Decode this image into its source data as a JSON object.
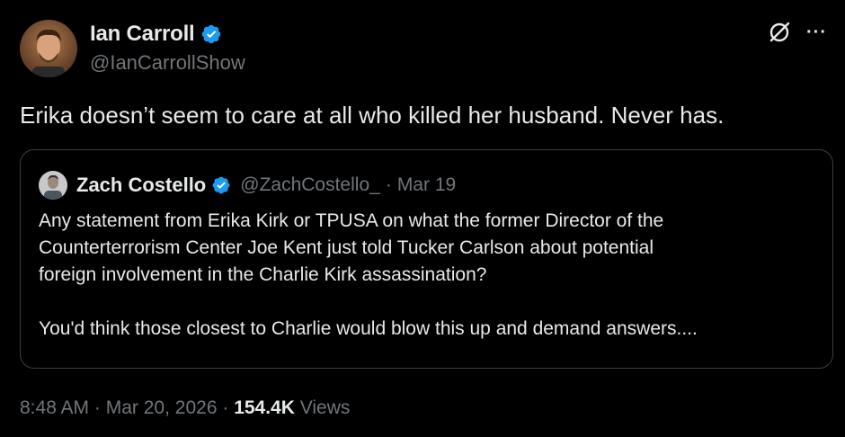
{
  "author": {
    "name": "Ian Carroll",
    "handle": "@IanCarrollShow",
    "verified": true
  },
  "tweet": {
    "text": "Erika doesn’t seem to care at all who killed her husband. Never has."
  },
  "quoted_tweet": {
    "author_name": "Zach Costello",
    "author_handle": "@ZachCostello_",
    "separator": "·",
    "date": "Mar 19",
    "verified": true,
    "body_lines": [
      "Any statement from Erika Kirk or TPUSA on what the former Director of the",
      "Counterterrorism Center Joe Kent just told Tucker Carlson about potential",
      "foreign involvement in the Charlie Kirk assassination?"
    ],
    "body_paragraph2": "You'd think those closest to Charlie would blow this up and demand answers...."
  },
  "meta": {
    "time": "8:48 AM",
    "sep1": "·",
    "date": "Mar 20, 2026",
    "sep2": "·",
    "views_count": "154.4K",
    "views_label": "Views"
  },
  "icons": {
    "verified": "verified-badge-icon",
    "grok": "grok-icon",
    "more": "more-options-icon"
  },
  "colors": {
    "background": "#000000",
    "text_primary": "#e7e9ea",
    "text_secondary": "#71767b",
    "verified_blue": "#1d9bf0",
    "card_border": "#3a3e42"
  }
}
